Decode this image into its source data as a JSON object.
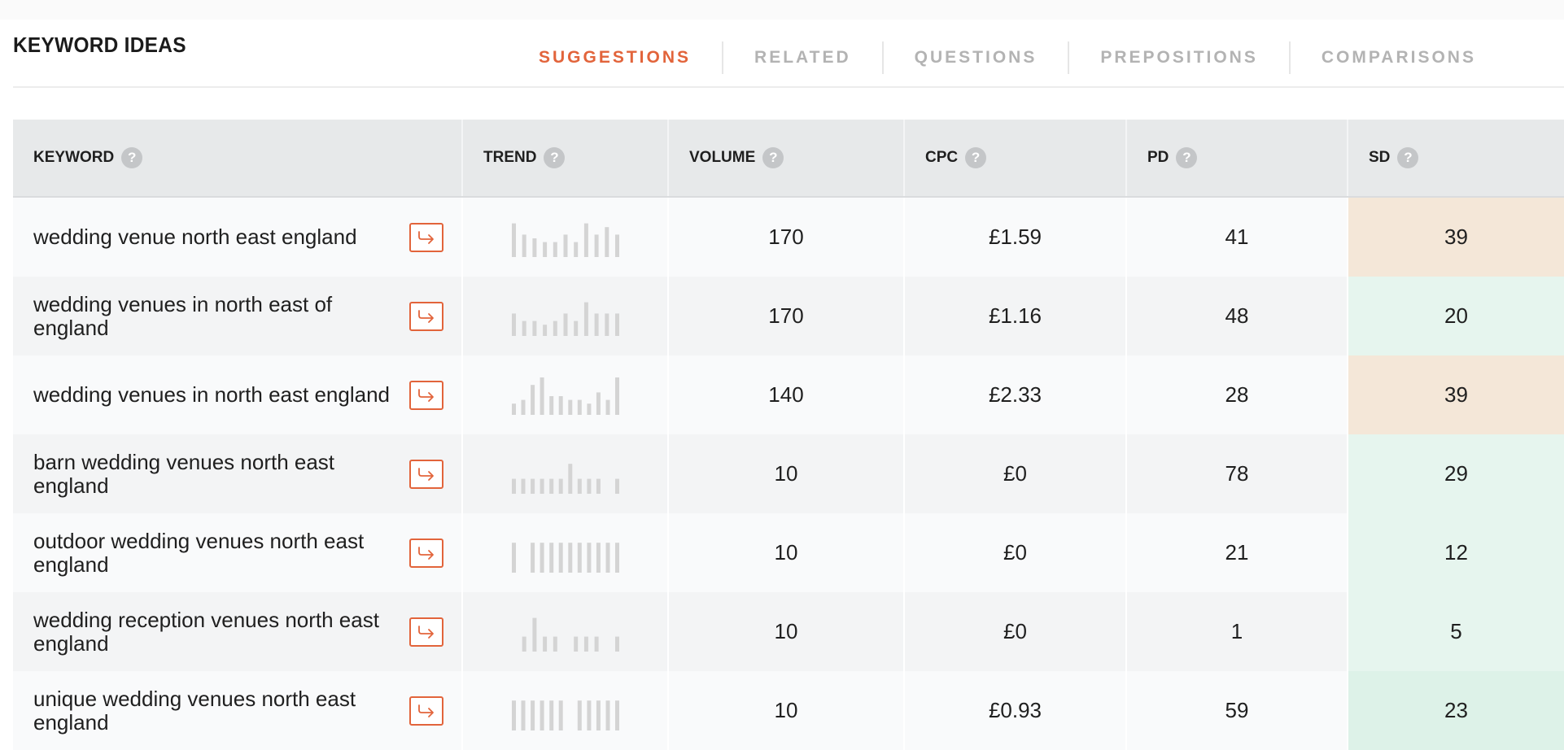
{
  "page": {
    "title": "KEYWORD IDEAS"
  },
  "tabs": [
    {
      "label": "SUGGESTIONS",
      "active": true
    },
    {
      "label": "RELATED",
      "active": false
    },
    {
      "label": "QUESTIONS",
      "active": false
    },
    {
      "label": "PREPOSITIONS",
      "active": false
    },
    {
      "label": "COMPARISONS",
      "active": false
    }
  ],
  "table": {
    "columns": {
      "keyword": "KEYWORD",
      "trend": "TREND",
      "volume": "VOLUME",
      "cpc": "CPC",
      "pd": "PD",
      "sd": "SD"
    },
    "help_glyph": "?",
    "rows": [
      {
        "keyword": "wedding venue north east england",
        "trend": [
          9,
          6,
          5,
          4,
          4,
          6,
          4,
          9,
          6,
          8,
          6
        ],
        "volume": "170",
        "cpc": "£1.59",
        "pd": "41",
        "sd": "39",
        "sd_color": "#f4e7d8"
      },
      {
        "keyword": "wedding venues in north east of england",
        "trend": [
          6,
          4,
          4,
          3,
          4,
          6,
          4,
          9,
          6,
          6,
          6
        ],
        "volume": "170",
        "cpc": "£1.16",
        "pd": "48",
        "sd": "20",
        "sd_color": "#e6f5ee"
      },
      {
        "keyword": "wedding venues in north east england",
        "trend": [
          3,
          4,
          8,
          10,
          5,
          5,
          4,
          4,
          3,
          6,
          4,
          10
        ],
        "volume": "140",
        "cpc": "£2.33",
        "pd": "28",
        "sd": "39",
        "sd_color": "#f4e7d8"
      },
      {
        "keyword": "barn wedding venues north east england",
        "trend": [
          4,
          4,
          4,
          4,
          4,
          4,
          8,
          4,
          4,
          4,
          0,
          4
        ],
        "volume": "10",
        "cpc": "£0",
        "pd": "78",
        "sd": "29",
        "sd_color": "#e6f5ee"
      },
      {
        "keyword": "outdoor wedding venues north east england",
        "trend": [
          8,
          0,
          8,
          8,
          8,
          8,
          8,
          8,
          8,
          8,
          8,
          8
        ],
        "volume": "10",
        "cpc": "£0",
        "pd": "21",
        "sd": "12",
        "sd_color": "#e6f5ee"
      },
      {
        "keyword": "wedding reception venues north east england",
        "trend": [
          0,
          4,
          9,
          4,
          4,
          0,
          4,
          4,
          4,
          0,
          4
        ],
        "volume": "10",
        "cpc": "£0",
        "pd": "1",
        "sd": "5",
        "sd_color": "#e6f5ee"
      },
      {
        "keyword": "unique wedding venues north east england",
        "trend": [
          8,
          8,
          8,
          8,
          8,
          8,
          0,
          8,
          8,
          8,
          8,
          8
        ],
        "volume": "10",
        "cpc": "£0.93",
        "pd": "59",
        "sd": "23",
        "sd_color": "#ddf2e8"
      }
    ]
  },
  "colors": {
    "accent": "#e2643b",
    "tab_inactive": "#b3b3b3",
    "header_bg": "#e7e9ea",
    "trend_bar": "#d4d4d4"
  },
  "icons": {
    "help": "question-circle-icon",
    "keyword_action": "arrow-enter-icon"
  }
}
